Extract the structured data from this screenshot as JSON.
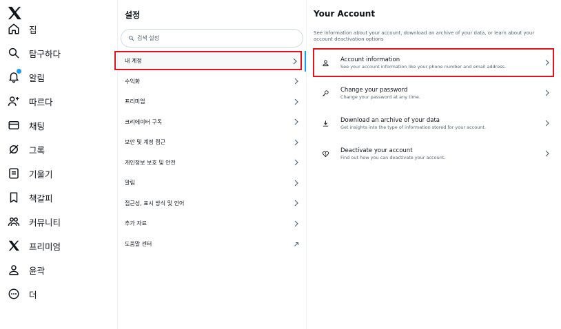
{
  "nav": {
    "items": [
      {
        "label": "집",
        "icon": "home-icon"
      },
      {
        "label": "탐구하다",
        "icon": "search-icon"
      },
      {
        "label": "알림",
        "icon": "bell-icon"
      },
      {
        "label": "따르다",
        "icon": "follow-icon"
      },
      {
        "label": "채팅",
        "icon": "mail-icon"
      },
      {
        "label": "그록",
        "icon": "grok-icon"
      },
      {
        "label": "기울기",
        "icon": "list-icon"
      },
      {
        "label": "책갈피",
        "icon": "bookmark-icon"
      },
      {
        "label": "커뮤니티",
        "icon": "communities-icon"
      },
      {
        "label": "프리미엄",
        "icon": "x-premium-icon"
      },
      {
        "label": "윤곽",
        "icon": "profile-icon"
      },
      {
        "label": "더",
        "icon": "more-icon"
      }
    ]
  },
  "settings": {
    "title": "설정",
    "search_placeholder": "검색 설정",
    "menu": [
      {
        "label": "내 계정",
        "active": true
      },
      {
        "label": "수익화"
      },
      {
        "label": "프리미엄"
      },
      {
        "label": "크리에이터 구독"
      },
      {
        "label": "보안 및 계정 접근"
      },
      {
        "label": "개인정보 보호 및 안전"
      },
      {
        "label": "알림"
      },
      {
        "label": "접근성, 표시 방식 및 언어"
      },
      {
        "label": "추가 자료"
      },
      {
        "label": "도움말 센터",
        "external": true
      }
    ]
  },
  "account": {
    "title": "Your Account",
    "description": "See information about your account, download an archive of your data, or learn about your account deactivation options",
    "items": [
      {
        "title": "Account information",
        "subtitle": "See your account information like your phone number and email address.",
        "icon": "person-icon"
      },
      {
        "title": "Change your password",
        "subtitle": "Change your password at any time.",
        "icon": "key-icon"
      },
      {
        "title": "Download an archive of your data",
        "subtitle": "Get insights into the type of information stored for your account.",
        "icon": "download-icon"
      },
      {
        "title": "Deactivate your account",
        "subtitle": "Find out how you can deactivate your account.",
        "icon": "broken-heart-icon"
      }
    ]
  },
  "colors": {
    "accent": "#1d9bf0",
    "highlight": "#e0121e",
    "text": "#0f1419",
    "muted": "#536471"
  }
}
